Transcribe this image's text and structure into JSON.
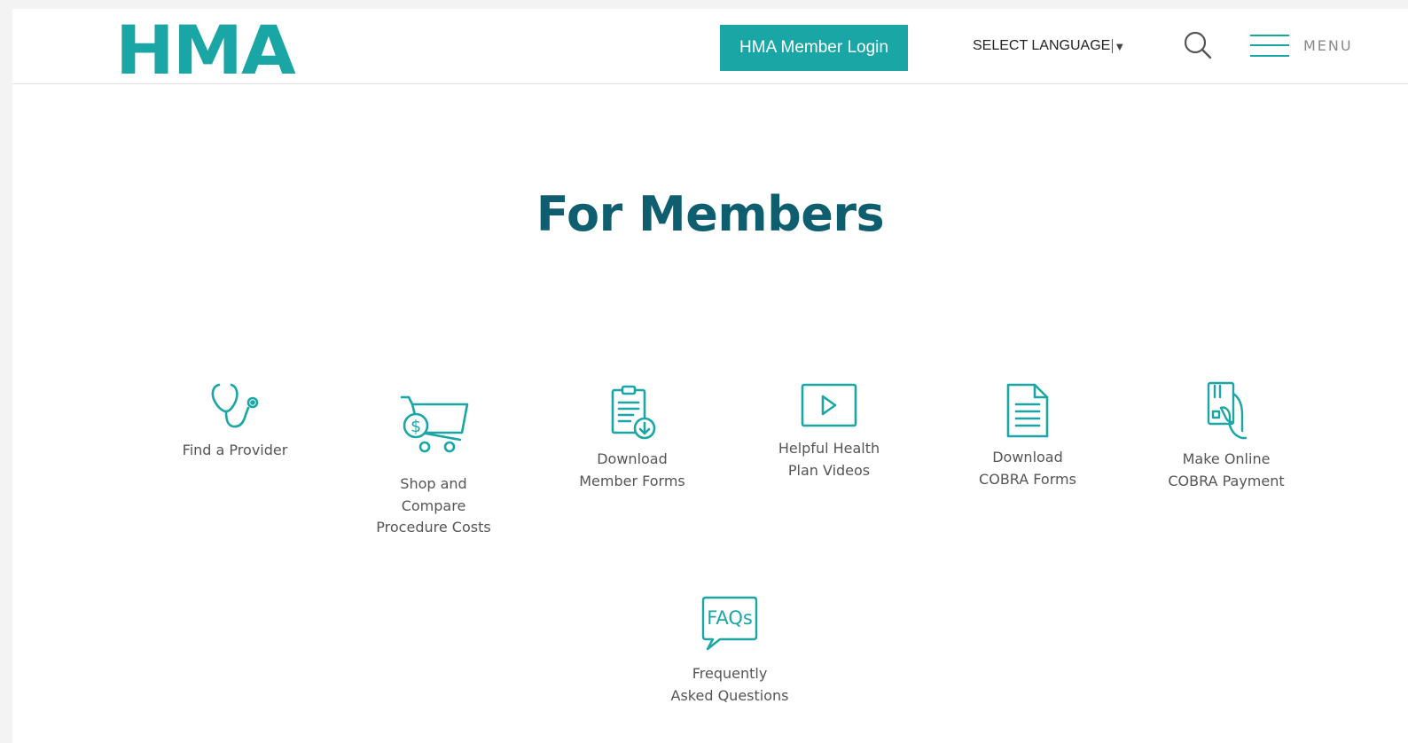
{
  "header": {
    "logo_text": "HMA",
    "login_label": "HMA Member Login",
    "language_label": "SELECT LANGUAGE",
    "language_arrow": "▼",
    "menu_label": "MENU"
  },
  "main": {
    "title": "For Members",
    "tiles": [
      {
        "icon": "stethoscope-icon",
        "label": "Find a Provider"
      },
      {
        "icon": "shopping-cart-icon",
        "label_lines": [
          "Shop and",
          "Compare",
          "Procedure Costs"
        ]
      },
      {
        "icon": "clipboard-download-icon",
        "label_lines": [
          "Download",
          "Member Forms"
        ]
      },
      {
        "icon": "video-play-icon",
        "label_lines": [
          "Helpful Health",
          "Plan Videos"
        ]
      },
      {
        "icon": "document-icon",
        "label_lines": [
          "Download",
          "COBRA Forms"
        ]
      },
      {
        "icon": "card-payment-icon",
        "label_lines": [
          "Make Online",
          "COBRA Payment"
        ]
      },
      {
        "icon": "faq-bubble-icon",
        "icon_text": "FAQs",
        "label_lines": [
          "Frequently",
          "Asked Questions"
        ]
      }
    ]
  },
  "colors": {
    "brand_teal": "#1ba6a6",
    "title_navy": "#0e5e70",
    "text_gray": "#555555"
  }
}
